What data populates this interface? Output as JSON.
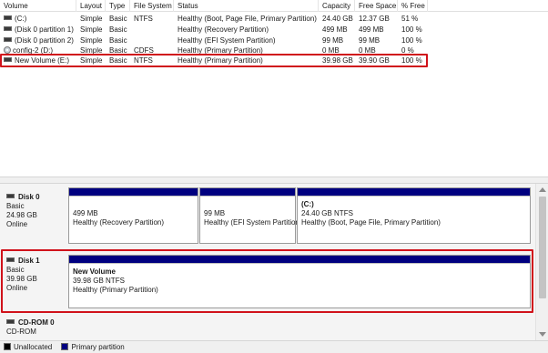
{
  "columns": {
    "volume": "Volume",
    "layout": "Layout",
    "type": "Type",
    "fs": "File System",
    "status": "Status",
    "capacity": "Capacity",
    "free": "Free Space",
    "pct": "% Free"
  },
  "volumes": [
    {
      "name": "(C:)",
      "icon": "disk-icon",
      "layout": "Simple",
      "type": "Basic",
      "fs": "NTFS",
      "status": "Healthy (Boot, Page File, Primary Partition)",
      "capacity": "24.40 GB",
      "free": "12.37 GB",
      "pct": "51 %"
    },
    {
      "name": "(Disk 0 partition 1)",
      "icon": "disk-icon",
      "layout": "Simple",
      "type": "Basic",
      "fs": "",
      "status": "Healthy (Recovery Partition)",
      "capacity": "499 MB",
      "free": "499 MB",
      "pct": "100 %"
    },
    {
      "name": "(Disk 0 partition 2)",
      "icon": "disk-icon",
      "layout": "Simple",
      "type": "Basic",
      "fs": "",
      "status": "Healthy (EFI System Partition)",
      "capacity": "99 MB",
      "free": "99 MB",
      "pct": "100 %"
    },
    {
      "name": "config-2 (D:)",
      "icon": "cd-icon",
      "layout": "Simple",
      "type": "Basic",
      "fs": "CDFS",
      "status": "Healthy (Primary Partition)",
      "capacity": "0 MB",
      "free": "0 MB",
      "pct": "0 %"
    },
    {
      "name": "New Volume (E:)",
      "icon": "disk-icon",
      "layout": "Simple",
      "type": "Basic",
      "fs": "NTFS",
      "status": "Healthy (Primary Partition)",
      "capacity": "39.98 GB",
      "free": "39.90 GB",
      "pct": "100 %"
    }
  ],
  "disks": {
    "disk0": {
      "name": "Disk 0",
      "type": "Basic",
      "size": "24.98 GB",
      "status": "Online",
      "partitions": [
        {
          "title": "",
          "size": "499 MB",
          "status": "Healthy (Recovery Partition)"
        },
        {
          "title": "",
          "size": "99 MB",
          "status": "Healthy (EFI System Partition)"
        },
        {
          "title": "(C:)",
          "size": "24.40 GB NTFS",
          "status": "Healthy (Boot, Page File, Primary Partition)"
        }
      ]
    },
    "disk1": {
      "name": "Disk 1",
      "type": "Basic",
      "size": "39.98 GB",
      "status": "Online",
      "partitions": [
        {
          "title": "New Volume",
          "size": "39.98 GB NTFS",
          "status": "Healthy (Primary Partition)"
        }
      ]
    },
    "cdrom0": {
      "name": "CD-ROM 0",
      "type": "CD-ROM"
    }
  },
  "legend": {
    "unallocated": "Unallocated",
    "primary": "Primary partition"
  },
  "colors": {
    "primary_partition": "#000080",
    "unallocated": "#000000",
    "highlight": "#d0121b"
  }
}
